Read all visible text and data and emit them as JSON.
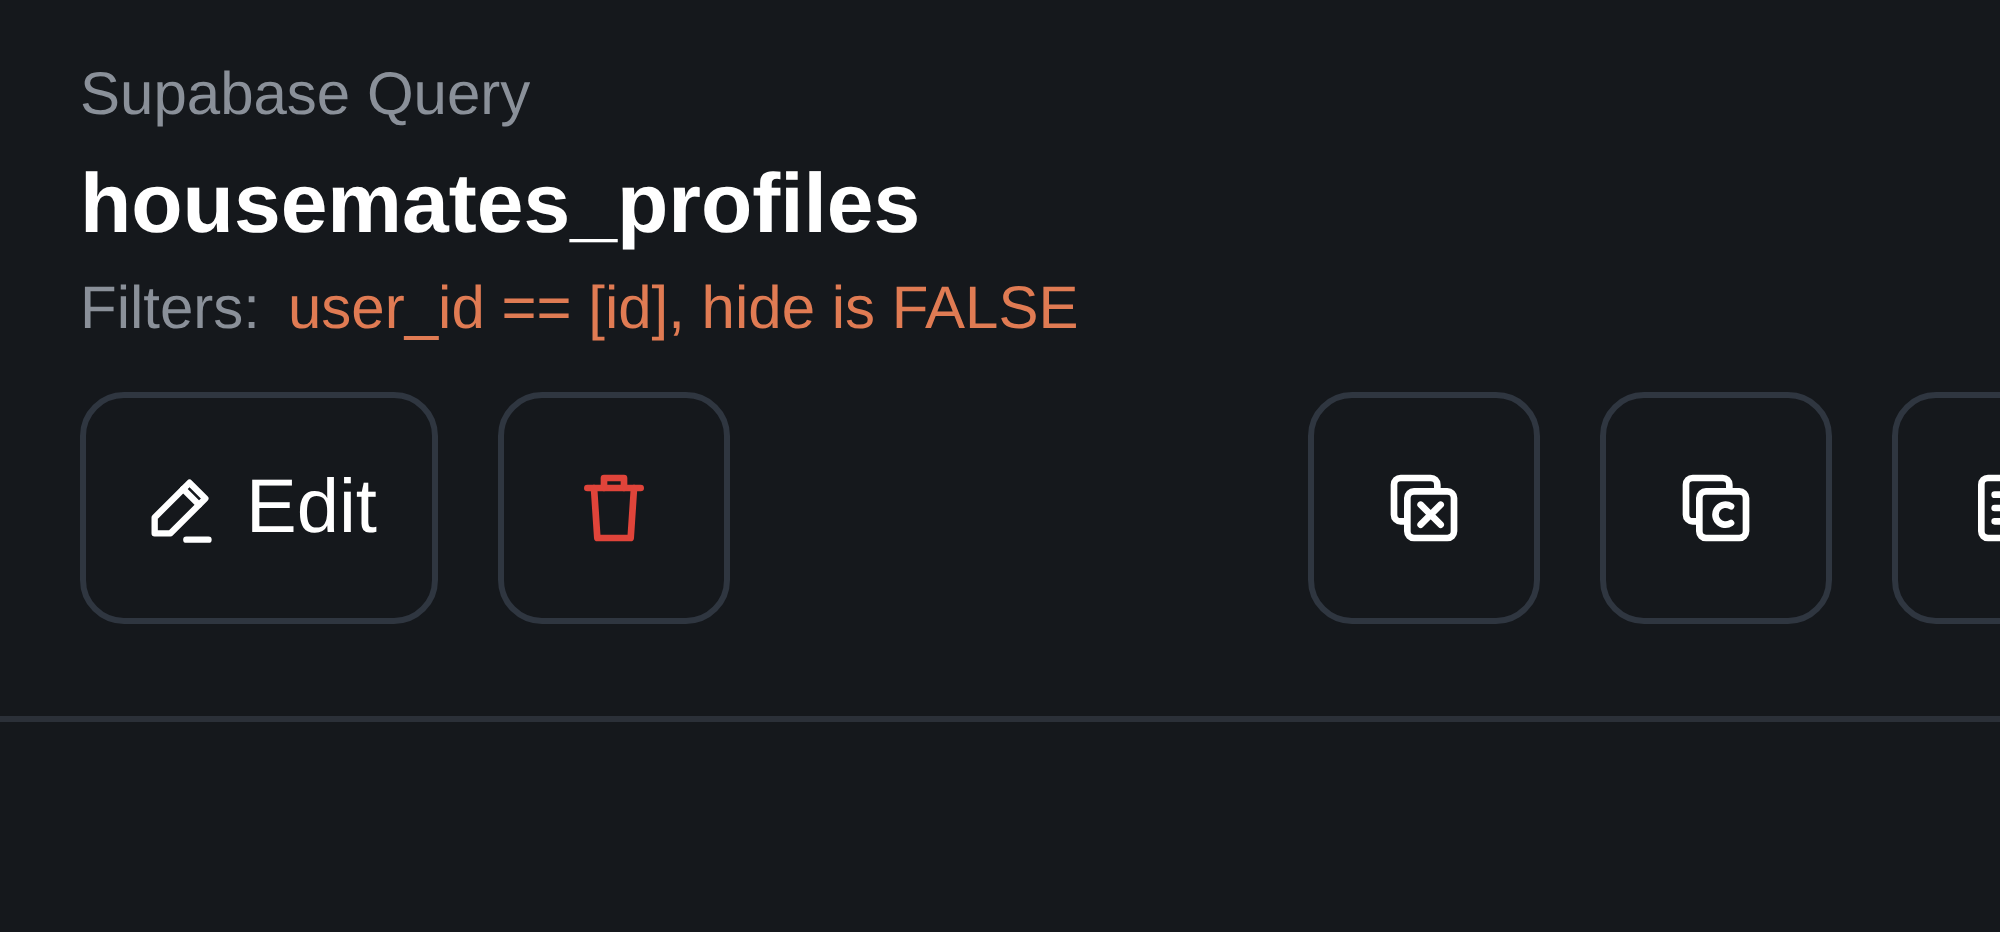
{
  "header": {
    "label": "Supabase Query",
    "title": "housemates_profiles",
    "filters_label": "Filters:",
    "filters_value": "user_id == [id], hide is FALSE"
  },
  "actions": [
    {
      "kind": "edit",
      "label": "Edit"
    },
    {
      "kind": "delete"
    }
  ],
  "tools": [
    {
      "kind": "variable"
    },
    {
      "kind": "copy"
    },
    {
      "kind": "document"
    }
  ]
}
